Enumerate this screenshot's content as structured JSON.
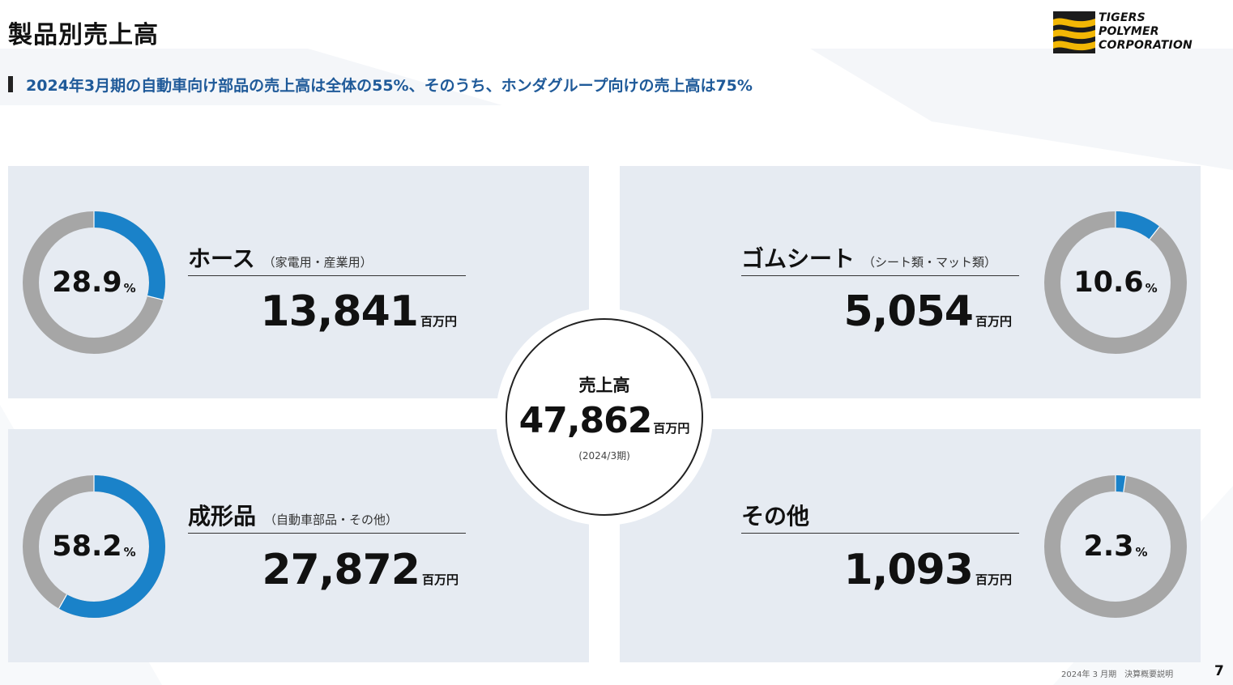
{
  "page": {
    "title": "製品別売上高",
    "subtitle": "2024年3月期の自動車向け部品の売上高は全体の55%、そのうち、ホンダグループ向けの売上高は75%",
    "footer": "2024年 3 月期　決算概要説明",
    "page_number": "7"
  },
  "logo": {
    "lines": [
      "TIGERS",
      "POLYMER",
      "CORPORATION"
    ]
  },
  "colors": {
    "accent": "#1a82c9",
    "ring_gray": "#a6a6a6",
    "panel_bg": "#e6ebf2",
    "subtitle_text": "#1f5a99"
  },
  "total": {
    "label": "売上高",
    "value": "47,862",
    "unit": "百万円",
    "period": "(2024/3期)"
  },
  "categories": [
    {
      "name": "ホース",
      "sub": "（家電用・産業用）",
      "value": "13,841",
      "unit": "百万円",
      "percent_label": "28.9",
      "percent_sign": "%",
      "share": 28.9
    },
    {
      "name": "ゴムシート",
      "sub": "（シート類・マット類）",
      "value": "5,054",
      "unit": "百万円",
      "percent_label": "10.6",
      "percent_sign": "%",
      "share": 10.6
    },
    {
      "name": "成形品",
      "sub": "（自動車部品・その他）",
      "value": "27,872",
      "unit": "百万円",
      "percent_label": "58.2",
      "percent_sign": "%",
      "share": 58.2
    },
    {
      "name": "その他",
      "sub": "",
      "value": "1,093",
      "unit": "百万円",
      "percent_label": "2.3",
      "percent_sign": "%",
      "share": 2.3
    }
  ],
  "chart_data": {
    "type": "pie",
    "categories": [
      "ホース",
      "ゴムシート",
      "成形品",
      "その他"
    ],
    "values": [
      28.9,
      10.6,
      58.2,
      2.3
    ],
    "title": "",
    "xlabel": "",
    "ylabel": ""
  }
}
